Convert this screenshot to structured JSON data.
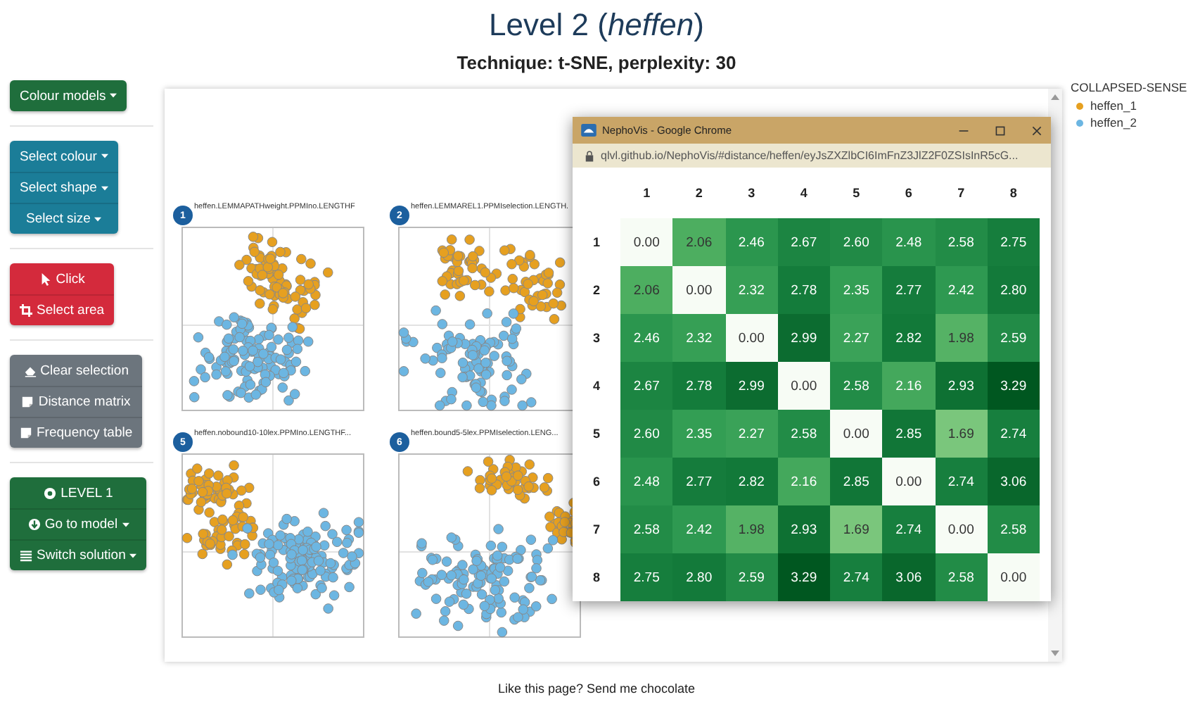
{
  "title": "Level 2 (*heffen*)",
  "subtitle": "Technique: t-SNE, perplexity: 30",
  "sidebar": {
    "groups": [
      {
        "kind": "success",
        "items": [
          {
            "label": "Colour models",
            "dropdown": true
          }
        ]
      },
      {
        "kind": "info",
        "items": [
          {
            "label": "Select colour",
            "dropdown": true
          },
          {
            "label": "Select shape",
            "dropdown": true
          },
          {
            "label": "Select size",
            "dropdown": true
          }
        ]
      },
      {
        "kind": "danger",
        "items": [
          {
            "label": "Click",
            "dropdown": false
          },
          {
            "label": "Select area",
            "dropdown": false
          }
        ]
      },
      {
        "kind": "secondary",
        "items": [
          {
            "label": "Clear selection",
            "dropdown": false
          },
          {
            "label": "Distance matrix",
            "dropdown": false
          },
          {
            "label": "Frequency table",
            "dropdown": false
          }
        ]
      },
      {
        "kind": "success",
        "items": [
          {
            "label": "LEVEL 1",
            "dropdown": false
          },
          {
            "label": "Go to model",
            "dropdown": true
          },
          {
            "label": "Switch solution",
            "dropdown": true
          }
        ]
      }
    ]
  },
  "plots": [
    {
      "number": "1",
      "title": "heffen.LEMMAPATHweight.PPMIno.LENGTHF"
    },
    {
      "number": "2",
      "title": "heffen.LEMMAREL1.PPMIselection.LENGTH."
    },
    {
      "number": "5",
      "title": "heffen.nobound10-10lex.PPMIno.LENGTHF..."
    },
    {
      "number": "6",
      "title": "heffen.bound5-5lex.PPMIselection.LENG..."
    }
  ],
  "legend": {
    "title": "COLLAPSED-SENSE",
    "items": [
      {
        "label": "heffen_1",
        "color": "#e6a020"
      },
      {
        "label": "heffen_2",
        "color": "#6cb6e2"
      }
    ]
  },
  "popup": {
    "title": "NephoVis - Google Chrome",
    "url": "qlvl.github.io/NephoVis/#distance/heffen/eyJsZXZlbCI6ImFnZ3JlZ2F0ZSIsInR5cG...",
    "matrix": {
      "columns": [
        "1",
        "2",
        "3",
        "4",
        "5",
        "6",
        "7",
        "8"
      ],
      "rows": [
        {
          "label": "1",
          "cells": [
            "0.00",
            "2.06",
            "2.46",
            "2.67",
            "2.60",
            "2.48",
            "2.58",
            "2.75"
          ]
        },
        {
          "label": "2",
          "cells": [
            "2.06",
            "0.00",
            "2.32",
            "2.78",
            "2.35",
            "2.77",
            "2.42",
            "2.80"
          ]
        },
        {
          "label": "3",
          "cells": [
            "2.46",
            "2.32",
            "0.00",
            "2.99",
            "2.27",
            "2.82",
            "1.98",
            "2.59"
          ]
        },
        {
          "label": "4",
          "cells": [
            "2.67",
            "2.78",
            "2.99",
            "0.00",
            "2.58",
            "2.16",
            "2.93",
            "3.29"
          ]
        },
        {
          "label": "5",
          "cells": [
            "2.60",
            "2.35",
            "2.27",
            "2.58",
            "0.00",
            "2.85",
            "1.69",
            "2.74"
          ]
        },
        {
          "label": "6",
          "cells": [
            "2.48",
            "2.77",
            "2.82",
            "2.16",
            "2.85",
            "0.00",
            "2.74",
            "3.06"
          ]
        },
        {
          "label": "7",
          "cells": [
            "2.58",
            "2.42",
            "1.98",
            "2.93",
            "1.69",
            "2.74",
            "0.00",
            "2.58"
          ]
        },
        {
          "label": "8",
          "cells": [
            "2.75",
            "2.80",
            "2.59",
            "3.29",
            "2.74",
            "3.06",
            "2.58",
            "0.00"
          ]
        }
      ]
    }
  },
  "footer": "Like this page? Send me chocolate"
}
